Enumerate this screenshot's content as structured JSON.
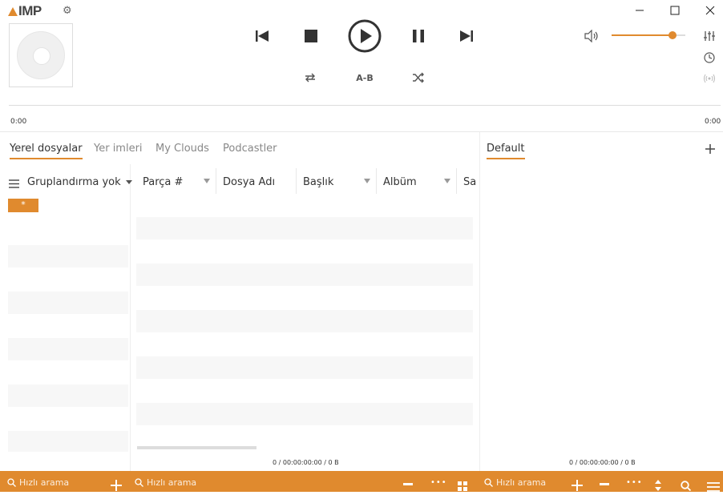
{
  "app": {
    "logo": "IMP"
  },
  "player": {
    "ab_label": "A-B",
    "time_start": "0:00",
    "time_end": "0:00",
    "volume_percent": 83
  },
  "library_tabs": [
    {
      "label": "Yerel dosyalar",
      "active": true
    },
    {
      "label": "Yer imleri",
      "active": false
    },
    {
      "label": "My Clouds",
      "active": false
    },
    {
      "label": "Podcastler",
      "active": false
    }
  ],
  "playlist_tab": {
    "label": "Default"
  },
  "grouping": {
    "label": "Gruplandırma yok",
    "filter_item": "*"
  },
  "columns": [
    "Parça #",
    "Dosya Adı",
    "Başlık",
    "Albüm",
    "Sa"
  ],
  "status": {
    "library": "0 / 00:00:00:00 / 0 B",
    "playlist": "0 / 00:00:00:00 / 0 B"
  },
  "search": {
    "placeholder_1": "Hızlı arama",
    "placeholder_2": "Hızlı arama",
    "placeholder_3": "Hızlı arama"
  },
  "colors": {
    "accent": "#e08a2e"
  }
}
